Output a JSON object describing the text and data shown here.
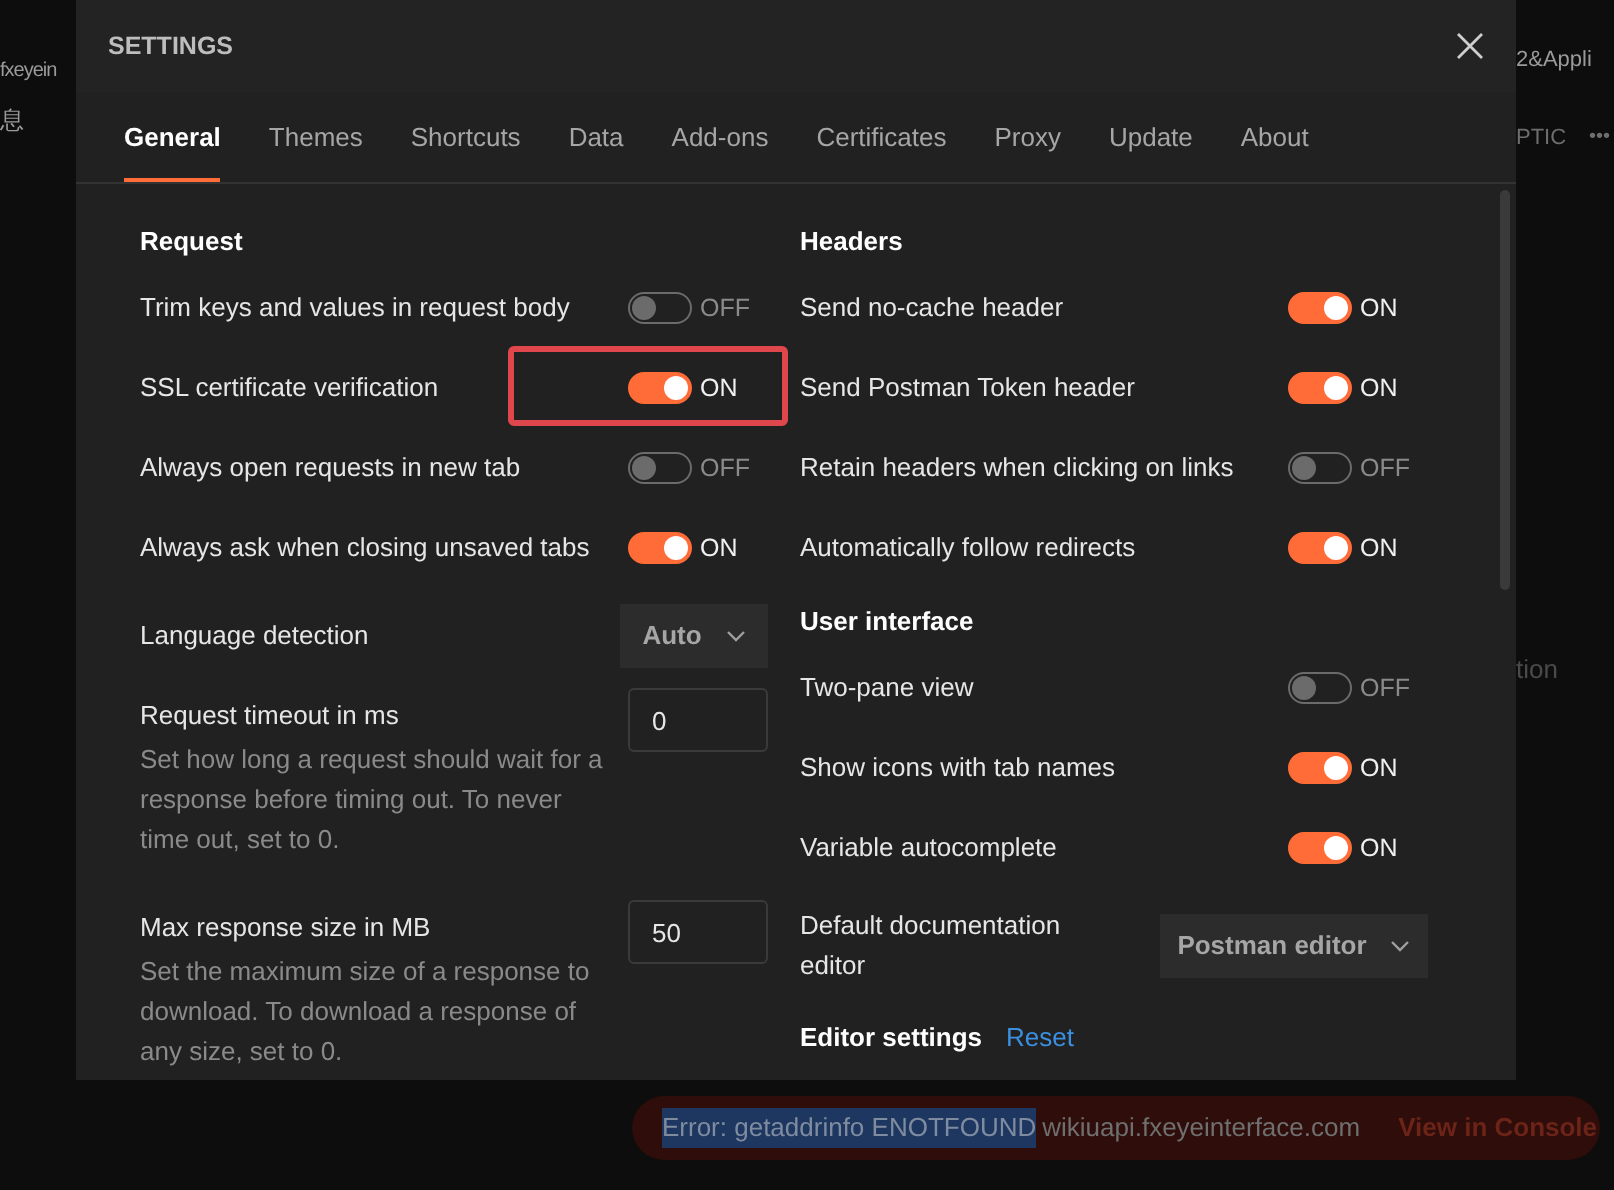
{
  "background": {
    "left_text": "fxeyein",
    "left_glyph": "息",
    "right_top_text": "2&Appli",
    "right_tab_text": "PTIC",
    "more_glyph": "•••",
    "right_mid_text": "tion"
  },
  "dialog": {
    "title": "SETTINGS",
    "tabs": [
      {
        "label": "General",
        "selected": true
      },
      {
        "label": "Themes",
        "selected": false
      },
      {
        "label": "Shortcuts",
        "selected": false
      },
      {
        "label": "Data",
        "selected": false
      },
      {
        "label": "Add-ons",
        "selected": false
      },
      {
        "label": "Certificates",
        "selected": false
      },
      {
        "label": "Proxy",
        "selected": false
      },
      {
        "label": "Update",
        "selected": false
      },
      {
        "label": "About",
        "selected": false
      }
    ],
    "columns": [
      [
        {
          "heading": "Request",
          "items": [
            {
              "kind": "toggle",
              "label": "Trim keys and values in request body",
              "on": false,
              "state_label": "OFF",
              "highlighted": false
            },
            {
              "kind": "toggle",
              "label": "SSL certificate verification",
              "on": true,
              "state_label": "ON",
              "highlighted": true
            },
            {
              "kind": "toggle",
              "label": "Always open requests in new tab",
              "on": false,
              "state_label": "OFF",
              "highlighted": false
            },
            {
              "kind": "toggle",
              "label": "Always ask when closing unsaved tabs",
              "on": true,
              "state_label": "ON",
              "highlighted": false
            },
            {
              "kind": "select",
              "label": "Language detection",
              "value": "Auto"
            },
            {
              "kind": "number",
              "label": "Request timeout in ms",
              "description": "Set how long a request should wait for a response before timing out. To never time out, set to 0.",
              "value": "0"
            },
            {
              "kind": "number",
              "label": "Max response size in MB",
              "description": "Set the maximum size of a response to download. To download a response of any size, set to 0.",
              "value": "50"
            }
          ]
        }
      ],
      [
        {
          "heading": "Headers",
          "items": [
            {
              "kind": "toggle",
              "label": "Send no-cache header",
              "on": true,
              "state_label": "ON",
              "highlighted": false
            },
            {
              "kind": "toggle",
              "label": "Send Postman Token header",
              "on": true,
              "state_label": "ON",
              "highlighted": false
            },
            {
              "kind": "toggle",
              "label": "Retain headers when clicking on links",
              "on": false,
              "state_label": "OFF",
              "highlighted": false
            },
            {
              "kind": "toggle",
              "label": "Automatically follow redirects",
              "on": true,
              "state_label": "ON",
              "highlighted": false
            }
          ]
        },
        {
          "heading": "User interface",
          "items": [
            {
              "kind": "toggle",
              "label": "Two-pane view",
              "on": false,
              "state_label": "OFF",
              "highlighted": false
            },
            {
              "kind": "toggle",
              "label": "Show icons with tab names",
              "on": true,
              "state_label": "ON",
              "highlighted": false
            },
            {
              "kind": "toggle",
              "label": "Variable autocomplete",
              "on": true,
              "state_label": "ON",
              "highlighted": false
            },
            {
              "kind": "wide_select",
              "label": "Default documentation editor",
              "value": "Postman editor"
            }
          ]
        },
        {
          "heading": "Editor settings",
          "link": "Reset"
        }
      ]
    ]
  },
  "error_banner": {
    "selected_text": "Error: getaddrinfo ENOTFOUND",
    "text": "wikiuapi.fxeyeinterface.com",
    "action": "View in Console"
  }
}
